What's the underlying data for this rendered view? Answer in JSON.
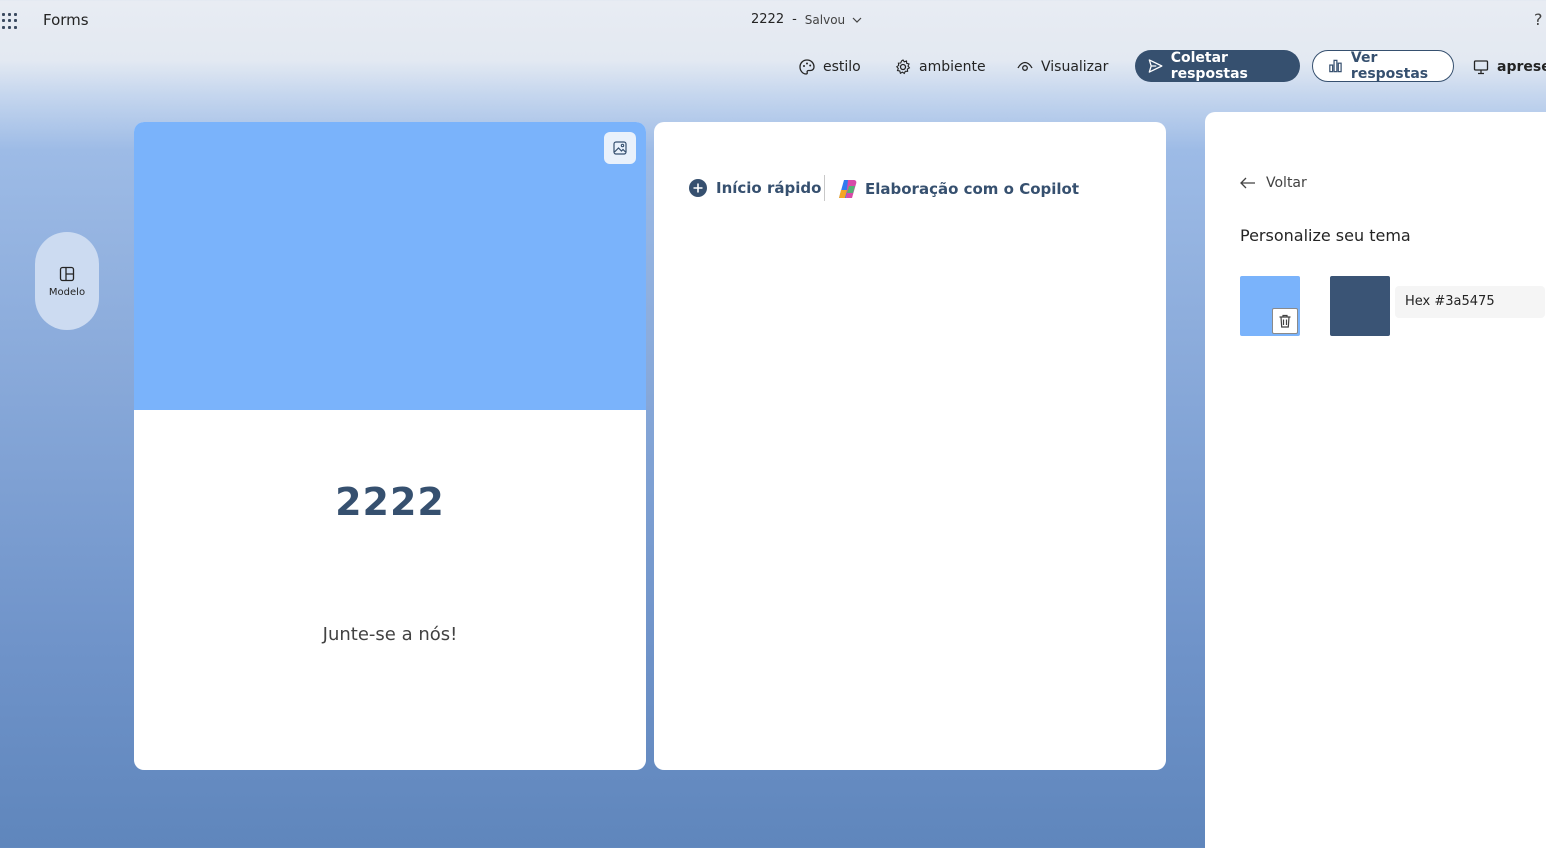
{
  "app": {
    "name": "Forms"
  },
  "document": {
    "title": "2222",
    "separator": "-",
    "status": "Salvou"
  },
  "toolbar": {
    "style_label": "estilo",
    "settings_label": "ambiente",
    "preview_label": "Visualizar",
    "collect_label": "Coletar respostas",
    "view_responses_label": "Ver respostas",
    "present_label": "apresentar"
  },
  "left_rail": {
    "template_label": "Modelo"
  },
  "form": {
    "title": "2222",
    "subtitle": "Junte-se a nós!"
  },
  "quick_actions": {
    "quick_start_label": "Início rápido",
    "copilot_label": "Elaboração com o Copilot"
  },
  "theme_panel": {
    "back_label": "Voltar",
    "title": "Personalize seu tema",
    "hex_value": "Hex #3a5475"
  },
  "colors": {
    "accent": "#36506f",
    "cover": "#7ab3fb",
    "swatch_light": "#7ab3fb",
    "swatch_dark": "#3a5475"
  }
}
